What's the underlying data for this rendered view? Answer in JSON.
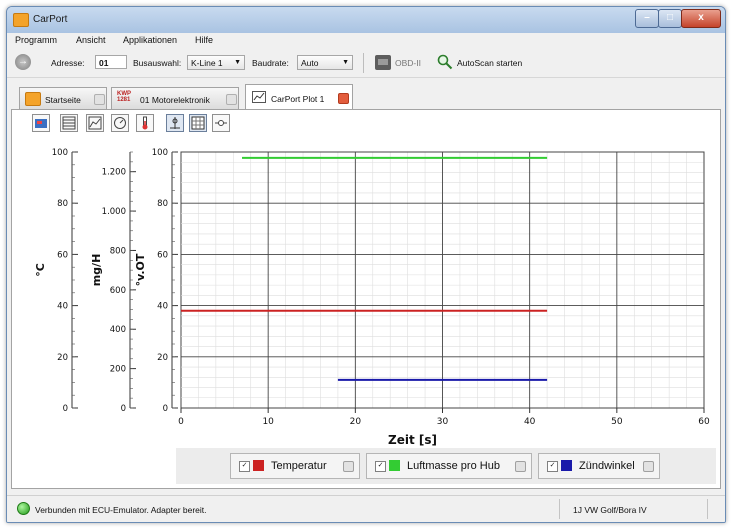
{
  "window": {
    "title": "CarPort",
    "minimize": "–",
    "maximize": "□",
    "close": "x"
  },
  "menu": [
    "Programm",
    "Ansicht",
    "Applikationen",
    "Hilfe"
  ],
  "toolbar": {
    "address_label": "Adresse:",
    "address_value": "01",
    "bus_label": "Busauswahl:",
    "bus_value": "K-Line 1",
    "baud_label": "Baudrate:",
    "baud_value": "Auto",
    "obd_label": "OBD-II",
    "autoscan_label": "AutoScan starten"
  },
  "tabs": [
    {
      "label": "Startseite",
      "active": false
    },
    {
      "label": "01 Motorelektronik",
      "badge": "KWP 1281",
      "active": false
    },
    {
      "label": "CarPort Plot 1",
      "active": true
    }
  ],
  "plot_tools": [
    "export-icon",
    "table-icon",
    "chart-icon",
    "gauge-icon",
    "thermometer-icon",
    "crosshair-icon",
    "grid-icon",
    "marker-icon"
  ],
  "chart_data": {
    "type": "line",
    "xlabel": "Zeit [s]",
    "x_ticks": [
      0,
      10,
      20,
      30,
      40,
      50,
      60
    ],
    "xlim": [
      0,
      60
    ],
    "grid": true,
    "legend_position": "bottom",
    "axes": [
      {
        "label": "°C",
        "lim": [
          0,
          100
        ],
        "ticks": [
          "0",
          "20",
          "40",
          "60",
          "80",
          "100"
        ]
      },
      {
        "label": "mg/H",
        "lim": [
          0,
          1300
        ],
        "ticks": [
          "0",
          "200",
          "400",
          "600",
          "800",
          "1.000",
          "1.200"
        ]
      },
      {
        "label": "°v.OT",
        "lim": [
          0,
          100
        ],
        "ticks": [
          "0",
          "20",
          "40",
          "60",
          "80",
          "100"
        ]
      }
    ],
    "series": [
      {
        "name": "Temperatur",
        "color": "#cc2222",
        "x": [
          0,
          42
        ],
        "y": [
          38,
          38
        ],
        "axis": "°C"
      },
      {
        "name": "Luftmasse pro Hub",
        "color": "#33cc33",
        "x": [
          7,
          42
        ],
        "y": [
          1270,
          1270
        ],
        "axis": "mg/H"
      },
      {
        "name": "Zündwinkel",
        "color": "#1a1aaa",
        "x": [
          18,
          42
        ],
        "y": [
          11,
          11
        ],
        "axis": "°v.OT"
      }
    ]
  },
  "status": {
    "message": "Verbunden mit ECU-Emulator. Adapter bereit.",
    "vehicle": "1J VW Golf/Bora IV"
  }
}
